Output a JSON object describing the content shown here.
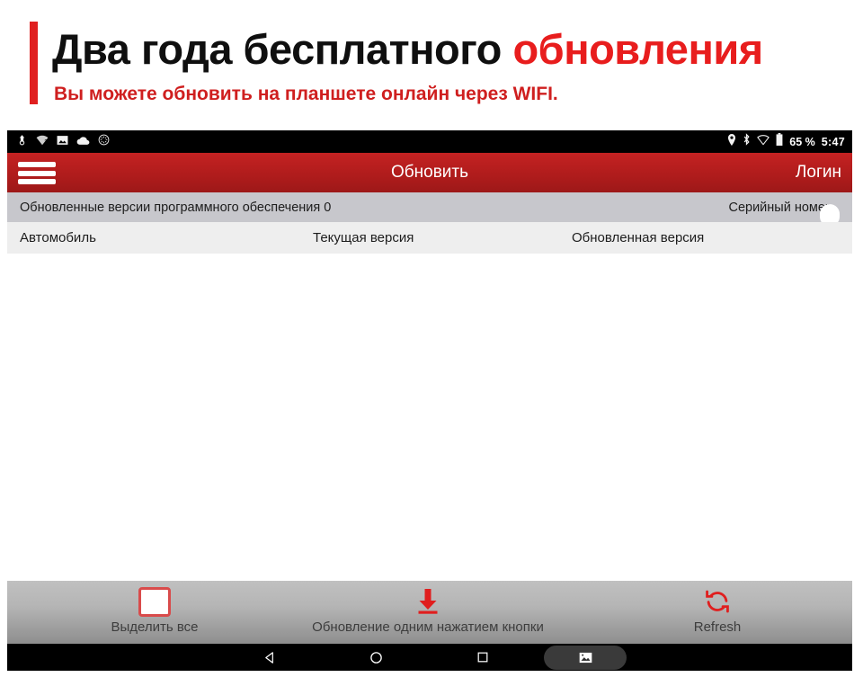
{
  "promo": {
    "title_black": "Два года бесплатного",
    "title_red": "обновления",
    "subtitle": "Вы можете обновить на планшете онлайн через WIFI.",
    "accent_color": "#e02020"
  },
  "status_bar": {
    "left_icons": [
      "usb-pointer-icon",
      "wifi-question-icon",
      "image-icon",
      "cloud-icon",
      "settings-circle-icon"
    ],
    "right_icons": [
      "location-pin-icon",
      "bluetooth-icon",
      "wifi-icon",
      "battery-icon"
    ],
    "battery_percent": "65 %",
    "time": "5:47"
  },
  "app_bar": {
    "menu_icon": "hamburger-menu-icon",
    "title": "Обновить",
    "action_label": "Логин",
    "background_color": "#b01c1c"
  },
  "info_bar": {
    "label": "Обновленные версии программного обеспечения 0",
    "serial_label": "Серийный номер",
    "serial_value": "",
    "serial_placeholder": ""
  },
  "table": {
    "columns": [
      "Автомобиль",
      "Текущая версия",
      "Обновленная версия"
    ],
    "rows": []
  },
  "action_bar": {
    "items": [
      {
        "icon": "checkbox-unchecked-icon",
        "label": "Выделить все"
      },
      {
        "icon": "download-arrow-icon",
        "label": "Обновление одним нажатием кнопки"
      },
      {
        "icon": "refresh-icon",
        "label": "Refresh"
      }
    ],
    "accent_color": "#e01e1e"
  },
  "nav_bar": {
    "buttons": [
      "back-triangle-icon",
      "home-circle-icon",
      "recents-square-icon",
      "screenshot-icon"
    ]
  }
}
